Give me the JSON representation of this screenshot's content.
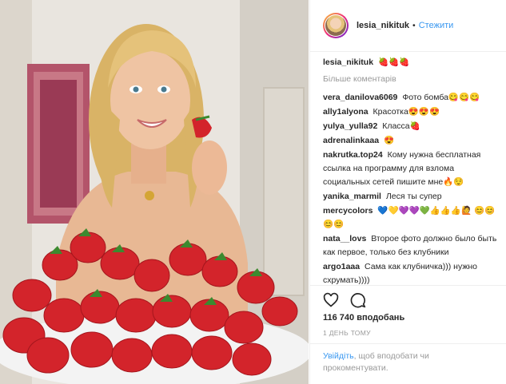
{
  "header": {
    "username": "lesia_nikituk",
    "separator": "•",
    "follow_label": "Стежити"
  },
  "caption": {
    "username": "lesia_nikituk",
    "text": "🍓🍓🍓"
  },
  "more_comments_label": "Більше коментарів",
  "comments": [
    {
      "user": "vera_danilova6069",
      "text": "Фото бомба😋😋😋"
    },
    {
      "user": "ally1alyona",
      "text": "Красотка😍😍😍"
    },
    {
      "user": "yulya_yulla92",
      "text": "Класса🍓"
    },
    {
      "user": "adrenalinkaaa",
      "text": "😍"
    },
    {
      "user": "nakrutka.top24",
      "text": "Кому нужна бесплатная ссылка на программу для взлома социальных сетей пишите мне🔥😌"
    },
    {
      "user": "yanika_marmil",
      "text": "Леся ты супер"
    },
    {
      "user": "mercycolors",
      "text": "💙💛💜💜💚👍👍👍🙋 😊😊😊😊"
    },
    {
      "user": "nata__lovs",
      "text": "Второе фото должно было быть как первое, только без клубники"
    },
    {
      "user": "argo1aaa",
      "text": "Сама как клубничка))) нужно схрумать))))"
    }
  ],
  "icons": [
    "heart-icon",
    "comment-icon"
  ],
  "likes": "116 740 вподобань",
  "time": "1 день тому",
  "login": {
    "link": "Увійдіть",
    "text": ", щоб вподобати чи прокоментувати."
  },
  "colors": {
    "link": "#3897f0",
    "muted": "#999999",
    "text": "#262626",
    "border": "#efefef"
  }
}
